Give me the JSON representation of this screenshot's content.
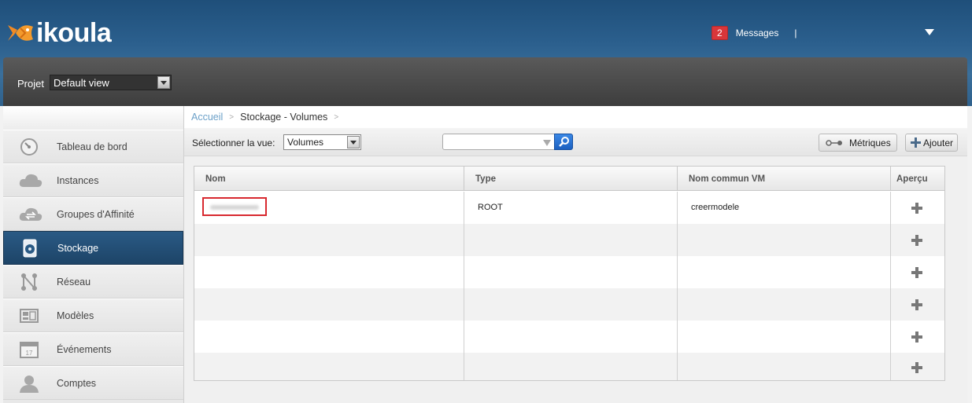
{
  "header": {
    "logo_text": "ikoula",
    "messages_count": "2",
    "messages_label": "Messages",
    "separator": "|"
  },
  "project": {
    "label": "Projet",
    "selected": "Default view"
  },
  "sidebar": {
    "items": [
      {
        "label": "Tableau de bord",
        "icon": "dashboard-icon"
      },
      {
        "label": "Instances",
        "icon": "cloud-icon"
      },
      {
        "label": "Groupes d'Affinité",
        "icon": "affinity-cloud-icon"
      },
      {
        "label": "Stockage",
        "icon": "storage-icon",
        "active": true
      },
      {
        "label": "Réseau",
        "icon": "network-icon"
      },
      {
        "label": "Modèles",
        "icon": "templates-icon"
      },
      {
        "label": "Événements",
        "icon": "calendar-icon"
      },
      {
        "label": "Comptes",
        "icon": "user-icon"
      }
    ]
  },
  "breadcrumb": {
    "home": "Accueil",
    "sep": ">",
    "current": "Stockage - Volumes"
  },
  "toolbar": {
    "view_label": "Sélectionner la vue:",
    "view_selected": "Volumes",
    "metrics_label": "Métriques",
    "add_label": "Ajouter"
  },
  "table": {
    "headers": [
      "Nom",
      "Type",
      "Nom commun VM",
      "Aperçu"
    ],
    "rows": [
      {
        "name": "",
        "type": "ROOT",
        "vm": "creermodele"
      },
      {
        "name": "",
        "type": "",
        "vm": ""
      },
      {
        "name": "",
        "type": "",
        "vm": ""
      },
      {
        "name": "",
        "type": "",
        "vm": ""
      },
      {
        "name": "",
        "type": "",
        "vm": ""
      },
      {
        "name": "",
        "type": "",
        "vm": ""
      }
    ]
  },
  "colors": {
    "header_blue": "#2b5f8d",
    "active_item": "#1d4467",
    "badge_red": "#d9363a",
    "search_blue": "#1c60c0",
    "highlight_red": "#d8292f"
  }
}
